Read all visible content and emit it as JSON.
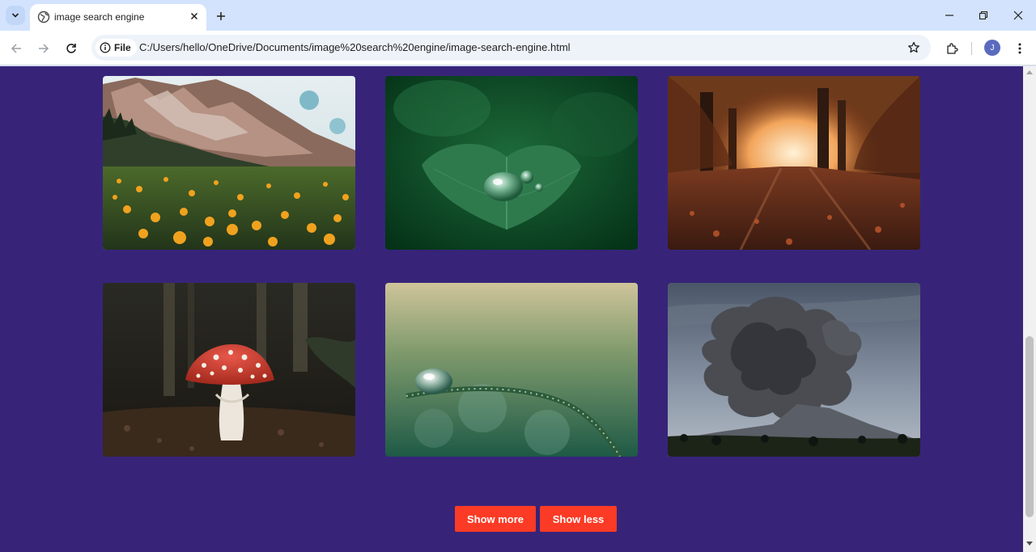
{
  "browser": {
    "tab_title": "image search engine",
    "site_chip_label": "File",
    "url": "C:/Users/hello/OneDrive/Documents/image%20search%20engine/image-search-engine.html",
    "profile_initial": "J"
  },
  "gallery": {
    "images": [
      {
        "subject": "mountain meadow with yellow flowers"
      },
      {
        "subject": "water droplet on green leaf"
      },
      {
        "subject": "autumn forest path"
      },
      {
        "subject": "red fly agaric mushroom"
      },
      {
        "subject": "dew drop on grass blade"
      },
      {
        "subject": "volcano ash cloud eruption"
      }
    ]
  },
  "actions": {
    "show_more_label": "Show more",
    "show_less_label": "Show less"
  },
  "colors": {
    "page_background": "#372479",
    "button_background": "#fb3b25",
    "button_text": "#ffffff"
  }
}
